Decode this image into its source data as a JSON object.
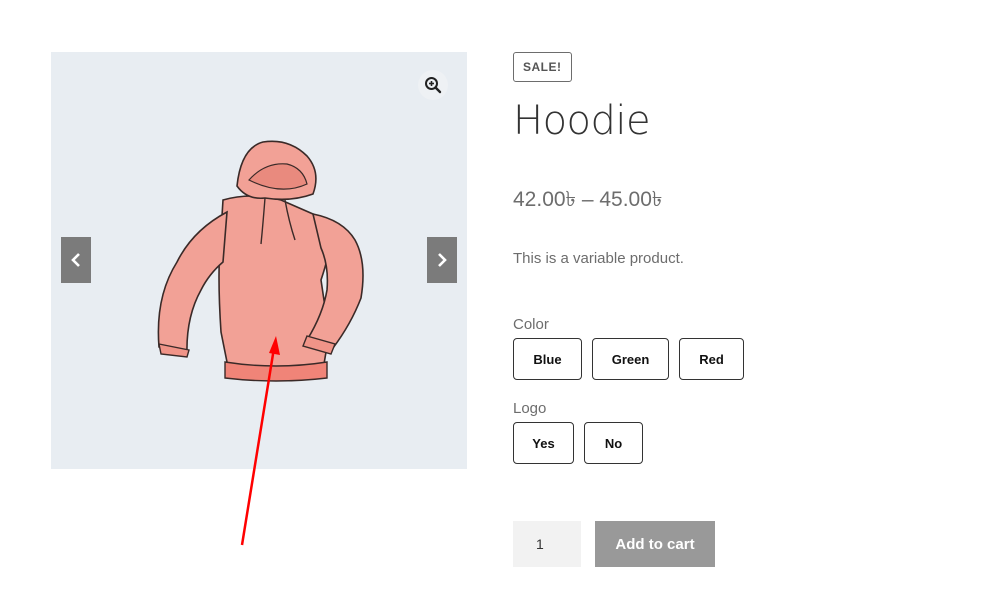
{
  "gallery": {
    "image_alt": "Hoodie",
    "zoom_icon": "zoom-in-icon",
    "prev_icon": "chevron-left-icon",
    "next_icon": "chevron-right-icon",
    "background": "#e8edf2"
  },
  "product": {
    "badge": "SALE!",
    "title": "Hoodie",
    "price": "42.00৳ – 45.00৳",
    "description": "This is a variable product."
  },
  "attributes": [
    {
      "label": "Color",
      "options": [
        "Blue",
        "Green",
        "Red"
      ]
    },
    {
      "label": "Logo",
      "options": [
        "Yes",
        "No"
      ]
    }
  ],
  "cart": {
    "quantity": "1",
    "add_to_cart_label": "Add to cart",
    "button_color": "#999999"
  },
  "annotation": {
    "arrow_color": "#ff0000"
  }
}
